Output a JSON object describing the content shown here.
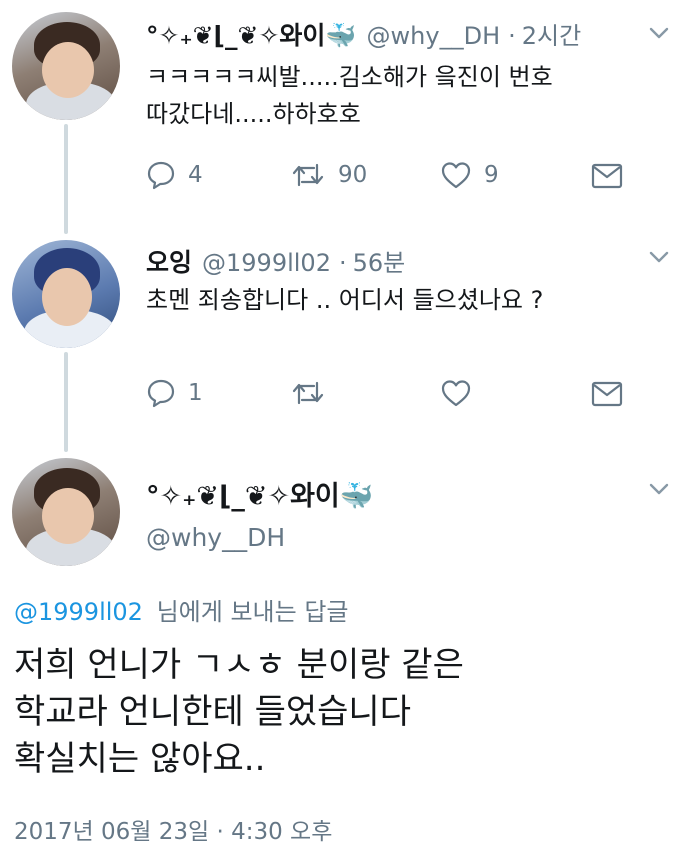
{
  "tweets": [
    {
      "display_name": "°✧₊❦⌊_❦✧와이🐳",
      "handle": "@why__DH",
      "time": "2시간",
      "text_lines": [
        "ㅋㅋㅋㅋㅋ씨발.....김소해가 읔진이 번호",
        "따갔다네.....하하호호"
      ],
      "reply_count": "4",
      "retweet_count": "90",
      "like_count": "9"
    },
    {
      "display_name": "오잉",
      "handle": "@1999ll02",
      "time": "56분",
      "text_lines": [
        "초멘 죄송합니다 .. 어디서 들으셨나요 ?"
      ],
      "reply_count": "1",
      "retweet_count": "",
      "like_count": ""
    }
  ],
  "focused_tweet": {
    "display_name": "°✧₊❦⌊_❦✧와이🐳",
    "handle": "@why__DH",
    "replying_to": "@1999ll02",
    "replying_suffix": "님에게 보내는 답글",
    "text_lines": [
      "저희 언니가 ㄱㅅㅎ 분이랑 같은",
      "학교라 언니한테 들었습니다",
      "확실치는 않아요.."
    ],
    "timestamp": "2017년 06월 23일 · 4:30 오후"
  },
  "colors": {
    "accent": "#1b95e0",
    "secondary_text": "#657786",
    "thread_line": "#cfd9de"
  }
}
